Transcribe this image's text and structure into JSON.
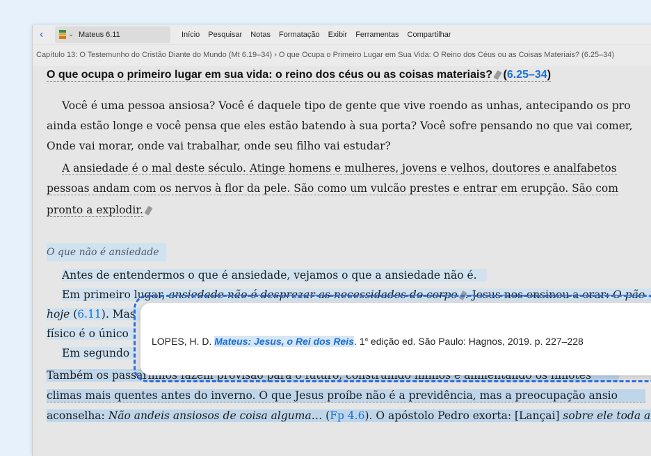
{
  "toolbar": {
    "book_title": "Mateus 6.11",
    "menu": [
      "Início",
      "Pesquisar",
      "Notas",
      "Formatação",
      "Exibir",
      "Ferramentas",
      "Compartilhar"
    ]
  },
  "breadcrumb": "Capítulo 13: O Testemunho do Cristão Diante do Mundo (Mt 6.19–34)  › O que Ocupa o Primeiro Lugar em Sua Vida: O Reino dos Céus ou as Coisas Materiais? (6.25–34)",
  "heading": {
    "text": "O que ocupa o primeiro lugar em sua vida: o reino dos céus ou as coisas materiais?",
    "ref_open": " (",
    "ref": "6.25–34",
    "ref_close": ")"
  },
  "paragraph1": [
    "Você é uma pessoa ansiosa? Você é daquele tipo de gente que vive roendo as unhas, antecipando os pro",
    "ainda estão longe e você pensa que eles estão batendo à sua porta? Você sofre pensando no que vai comer,",
    "Onde vai morar, onde vai trabalhar, onde seu filho vai estudar?"
  ],
  "paragraph2": [
    "A ansiedade é o mal deste século. Atinge homens e mulheres, jovens e velhos, doutores e analfabetos",
    "pessoas andam com os nervos à flor da pele. São como um vulcão prestes e entrar em erupção. São com",
    "pronto a explodir."
  ],
  "subhead": "O que não é ansiedade",
  "paragraph3": {
    "line1": "Antes de entendermos o que é ansiedade, vejamos o que a ansiedade não é.",
    "line2_a": "Em primeiro lugar, ",
    "line2_b": "ansiedade não é desprezar as necessidades do corpo",
    "line2_c": ". Jesus nos ensinou a orar: ",
    "line2_d": "O pão",
    "line3_a": "hoje",
    "line3_b": " (",
    "line3_ref": "6.11",
    "line3_c": "). Mas",
    "line4": "físico é o único",
    "line5": "Em segundo"
  },
  "paragraph4": {
    "line1": "Também os passarinhos fazem provisão para o futuro, construindo ninhos e alimentando os filhotes",
    "line2": "climas mais quentes antes do inverno. O que Jesus proíbe não é a previdência, mas a preocupação ansio",
    "line3_a": "aconselha: ",
    "line3_b": "Não andeis ansiosos de coisa alguma…",
    "line3_c": " (",
    "line3_ref": "Fp 4.6",
    "line3_d": "). O apóstolo Pedro exorta: [Lançai] ",
    "line3_e": "sobre ele toda a"
  },
  "popup": {
    "author": "LOPES, H. D. ",
    "title": "Mateus: Jesus, o Rei dos Reis",
    "after_title": ". 1",
    "sup": "a",
    "rest": " edição ed. São Paulo: Hagnos, 2019. p. 227–228"
  }
}
